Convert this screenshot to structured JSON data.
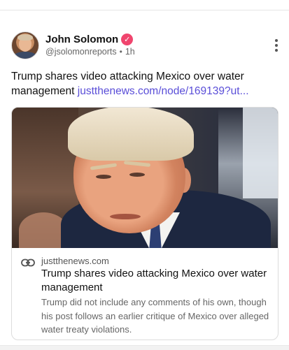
{
  "post": {
    "author": {
      "name": "John Solomon",
      "handle": "@jsolomonreports",
      "time": "1h",
      "verified_mark": "✓"
    },
    "text": "Trump shares video attacking Mexico over water management ",
    "link_text": "justthenews.com/node/169139?ut..."
  },
  "card": {
    "domain": "justthenews.com",
    "title": "Trump shares video attacking Mexico over water management",
    "description": "Trump did not include any comments of his own, though his post follows an earlier critique of Mexico over alleged water treaty violations."
  },
  "icons": {
    "verified": "verified-badge-icon",
    "more": "more-options-icon",
    "link": "link-icon"
  },
  "colors": {
    "accent_link": "#5a4ed8",
    "verified_badge": "#f0456e"
  }
}
